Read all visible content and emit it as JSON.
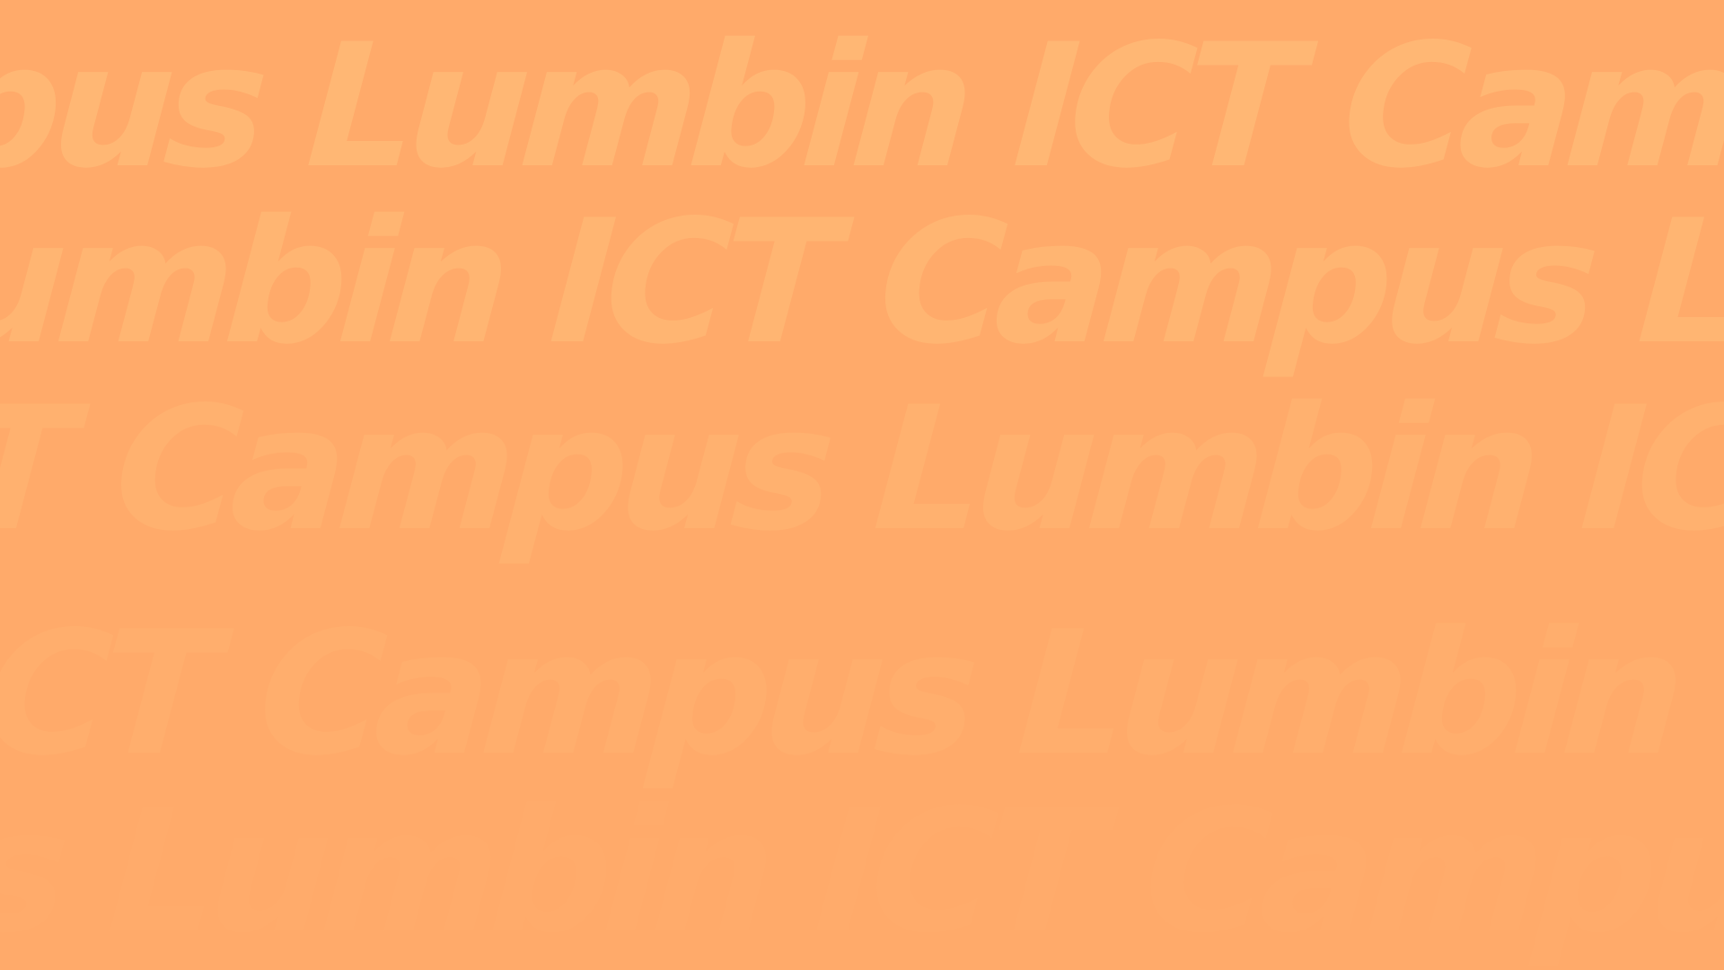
{
  "background": {
    "color": "#FFAA6A",
    "rows": [
      {
        "text": "pus Lumbin ICT Camp",
        "color": "#FFB774"
      },
      {
        "text": "umbin ICT Campus Lu",
        "color": "#FFB572"
      },
      {
        "text": "T Campus Lumbin ICT",
        "color": "#FFB16F"
      },
      {
        "text": "ICT Campus Lumbin I",
        "color": "#FFAE6D"
      },
      {
        "text": "s Lumbin ICT Campus",
        "color": "#FFAB6B"
      }
    ]
  }
}
